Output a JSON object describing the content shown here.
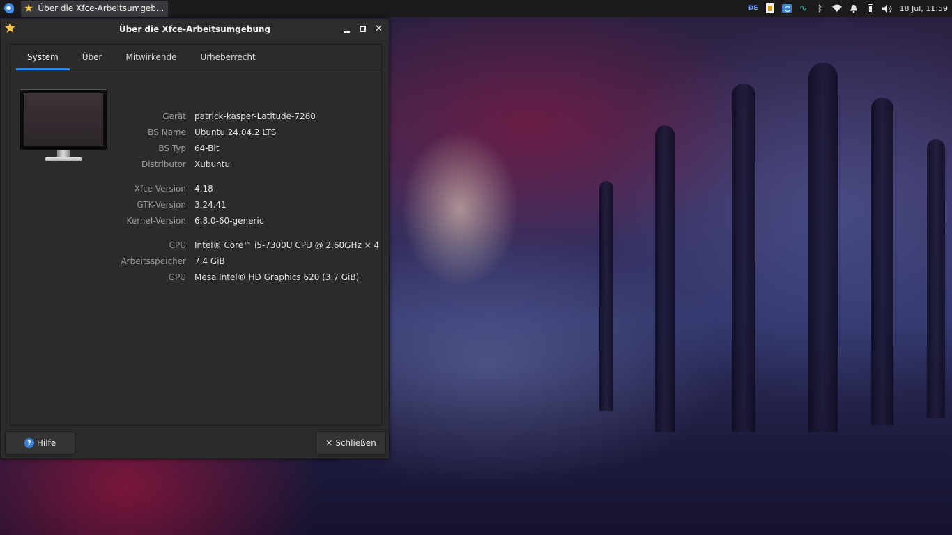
{
  "panel": {
    "taskbar_title": "Über die Xfce-Arbeitsumgeb...",
    "keyboard_layout": "DE",
    "clock": "18 Jul, 11:59"
  },
  "window": {
    "title": "Über die Xfce-Arbeitsumgebung",
    "tabs": [
      {
        "label": "System",
        "active": true
      },
      {
        "label": "Über",
        "active": false
      },
      {
        "label": "Mitwirkende",
        "active": false
      },
      {
        "label": "Urheberrecht",
        "active": false
      }
    ],
    "info": [
      {
        "label": "Gerät",
        "value": "patrick-kasper-Latitude-7280"
      },
      {
        "label": "BS Name",
        "value": "Ubuntu 24.04.2 LTS"
      },
      {
        "label": "BS Typ",
        "value": "64-Bit"
      },
      {
        "label": "Distributor",
        "value": "Xubuntu"
      },
      {
        "label": "Xfce Version",
        "value": "4.18"
      },
      {
        "label": "GTK-Version",
        "value": "3.24.41"
      },
      {
        "label": "Kernel-Version",
        "value": "6.8.0-60-generic"
      },
      {
        "label": "CPU",
        "value": "Intel® Core™ i5-7300U CPU @ 2.60GHz × 4"
      },
      {
        "label": "Arbeitsspeicher",
        "value": "7.4 GiB"
      },
      {
        "label": "GPU",
        "value": "Mesa Intel® HD Graphics 620 (3.7 GiB)"
      }
    ],
    "help_label": "Hilfe",
    "close_label": "Schließen"
  },
  "colors": {
    "accent": "#3584e4",
    "window_bg": "#2b2b2b",
    "panel_bg": "#1b1b1e"
  }
}
